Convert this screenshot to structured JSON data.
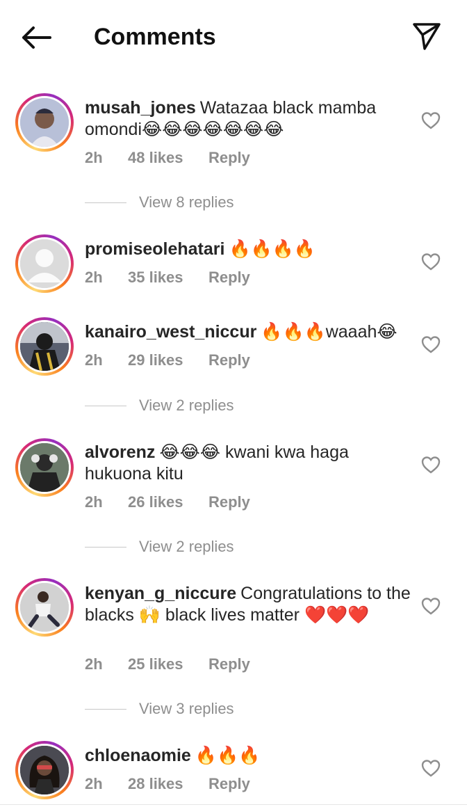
{
  "header": {
    "title": "Comments"
  },
  "comments": [
    {
      "username": "musah_jones",
      "text": "Watazaa black mamba omondi😂😂😂😂😂😂😂",
      "time": "2h",
      "likes": "48 likes",
      "reply": "Reply",
      "view_replies": "View 8 replies"
    },
    {
      "username": "promiseolehatari",
      "text": "🔥🔥🔥🔥",
      "time": "2h",
      "likes": "35 likes",
      "reply": "Reply"
    },
    {
      "username": "kanairo_west_niccur",
      "text": "🔥🔥🔥waaah😂",
      "time": "2h",
      "likes": "29 likes",
      "reply": "Reply",
      "view_replies": "View 2 replies"
    },
    {
      "username": "alvorenz",
      "text": "😂😂😂 kwani kwa haga hukuona kitu",
      "time": "2h",
      "likes": "26 likes",
      "reply": "Reply",
      "view_replies": "View 2 replies"
    },
    {
      "username": "kenyan_g_niccure",
      "text": "Congratulations to the blacks 🙌 black lives matter ❤️❤️❤️",
      "time": "2h",
      "likes": "25 likes",
      "reply": "Reply",
      "view_replies": "View 3 replies"
    },
    {
      "username": "chloenaomie",
      "text": "🔥🔥🔥",
      "time": "2h",
      "likes": "28 likes",
      "reply": "Reply"
    }
  ],
  "icons": {
    "back": "arrow-left-icon",
    "share": "send-icon",
    "like": "heart-outline-icon"
  },
  "colors": {
    "text": "#262626",
    "secondary": "#8e8e8e",
    "ring_start": "#feda75",
    "ring_mid": "#d62976",
    "ring_end": "#962fbf"
  }
}
